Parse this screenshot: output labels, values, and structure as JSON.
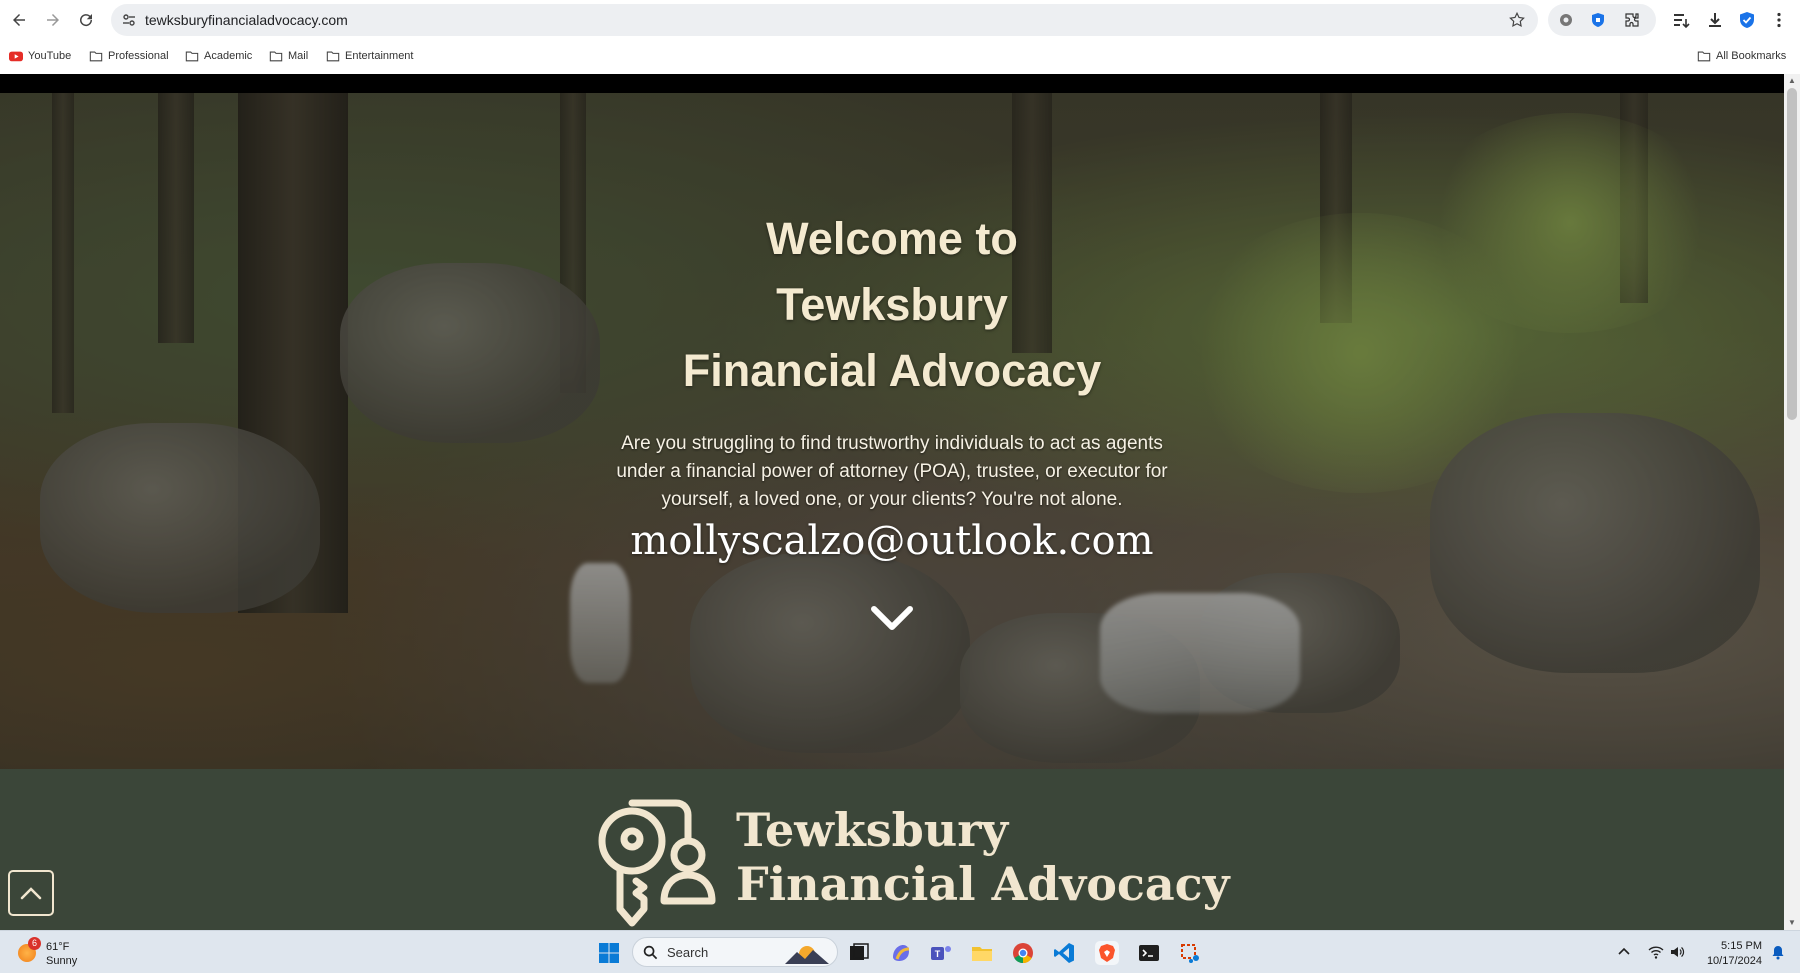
{
  "browser": {
    "url": "tewksburyfinancialadvocacy.com",
    "bookmarks": [
      "YouTube",
      "Professional",
      "Academic",
      "Mail",
      "Entertainment"
    ],
    "all_bookmarks_label": "All Bookmarks"
  },
  "hero": {
    "title_line1": "Welcome to",
    "title_line2": "Tewksbury",
    "title_line3": "Financial Advocacy",
    "intro": "Are you struggling to find trustworthy individuals to act as agents under a financial power of attorney (POA), trustee, or executor for yourself, a loved one, or your clients? You're not alone.",
    "email": "mollyscalzo@outlook.com"
  },
  "logo": {
    "line1": "Tewksbury",
    "line2": "Financial Advocacy"
  },
  "taskbar": {
    "weather_temp": "61°F",
    "weather_condition": "Sunny",
    "weather_badge": "6",
    "search_label": "Search",
    "time": "5:15 PM",
    "date": "10/17/2024"
  },
  "colors": {
    "brand_green": "#3b4639",
    "brand_cream": "#f1e6cf"
  }
}
